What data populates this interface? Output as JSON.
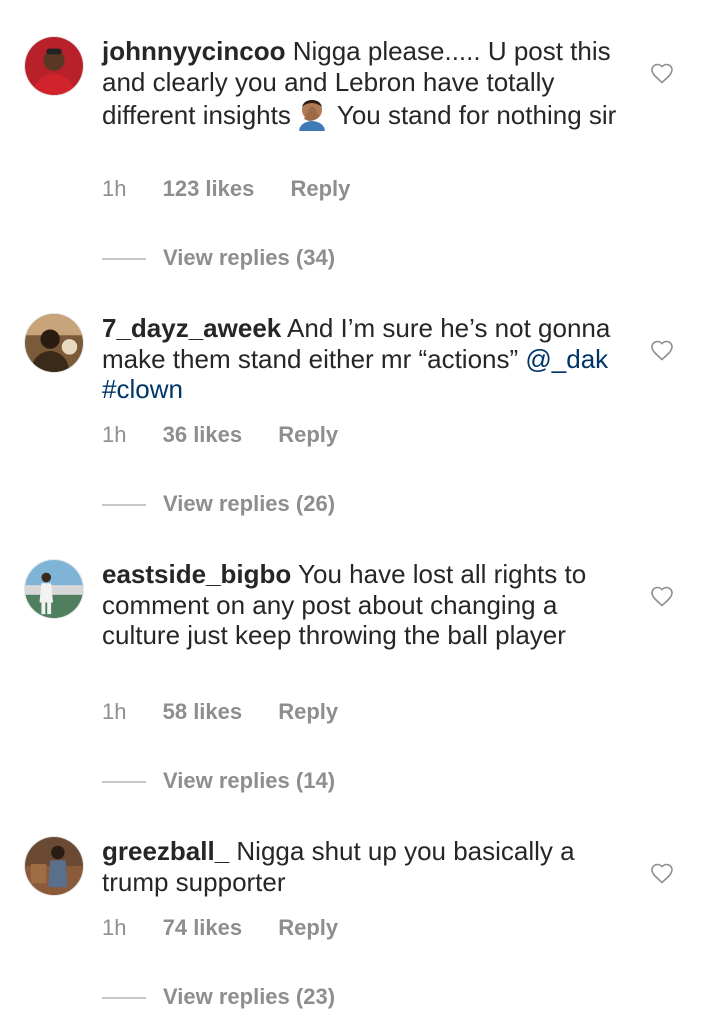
{
  "comments": [
    {
      "username": "johnnyycincoo",
      "text_before_emoji": "Nigga please..... U post this and clearly you and Lebron have totally different insights",
      "emoji": "face-palm-emoji",
      "text_after_emoji": "You stand for nothing sir",
      "time": "1h",
      "likes": "123 likes",
      "reply_label": "Reply",
      "view_replies": "View replies (34)"
    },
    {
      "username": "7_dayz_aweek",
      "text": "And I’m sure he’s not gonna make them stand either mr “actions”",
      "mention": "@_dak",
      "hashtag": "#clown",
      "time": "1h",
      "likes": "36 likes",
      "reply_label": "Reply",
      "view_replies": "View replies (26)"
    },
    {
      "username": "eastside_bigbo",
      "text": "You have lost all rights to comment on any post about changing a culture just keep throwing the ball player",
      "time": "1h",
      "likes": "58 likes",
      "reply_label": "Reply",
      "view_replies": "View replies (14)"
    },
    {
      "username": "greezball_",
      "text": "Nigga shut up you basically a trump supporter",
      "time": "1h",
      "likes": "74 likes",
      "reply_label": "Reply",
      "view_replies": "View replies (23)"
    }
  ],
  "colors": {
    "text": "#262626",
    "meta": "#8e8e8e",
    "link": "#003569",
    "divider": "#c7c7c7"
  },
  "icons": {
    "like": "heart-outline-icon"
  }
}
